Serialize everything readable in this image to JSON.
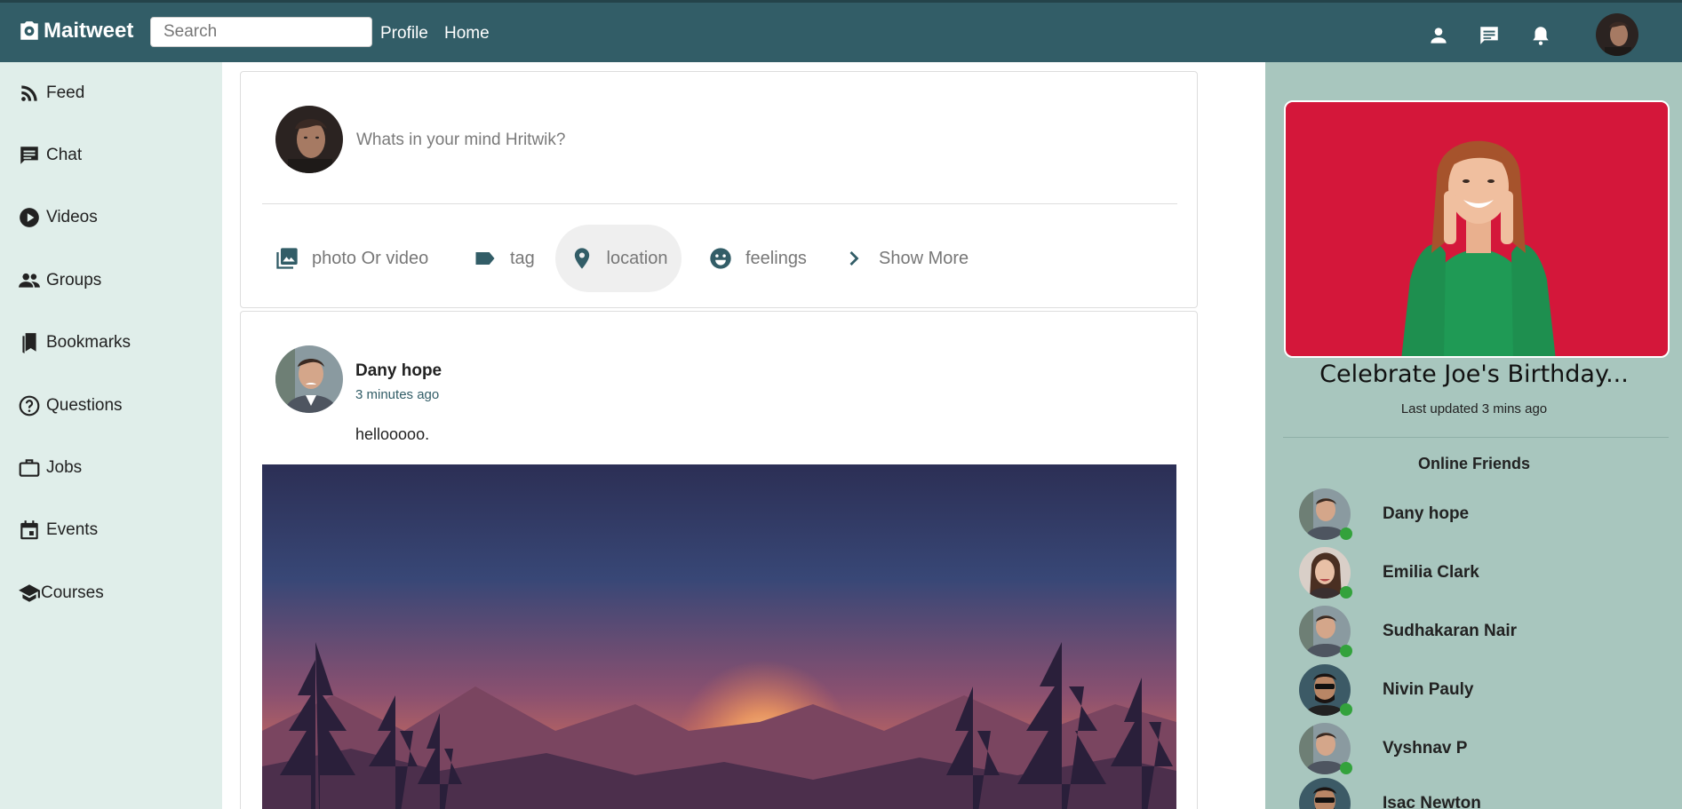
{
  "header": {
    "brand": "Maitweet",
    "search_placeholder": "Search",
    "nav": [
      "Profile",
      "Home"
    ],
    "icons": [
      "person-icon",
      "chat-icon",
      "bell-icon"
    ]
  },
  "sidebar": {
    "items": [
      {
        "label": "Feed",
        "icon": "rss-icon"
      },
      {
        "label": "Chat",
        "icon": "chat-icon"
      },
      {
        "label": "Videos",
        "icon": "play-icon"
      },
      {
        "label": "Groups",
        "icon": "group-icon"
      },
      {
        "label": "Bookmarks",
        "icon": "bookmark-icon"
      },
      {
        "label": "Questions",
        "icon": "help-icon"
      },
      {
        "label": "Jobs",
        "icon": "briefcase-icon"
      },
      {
        "label": "Events",
        "icon": "calendar-icon"
      },
      {
        "label": "Courses",
        "icon": "school-icon"
      }
    ]
  },
  "composer": {
    "placeholder": "Whats in your mind Hritwik?",
    "options": [
      {
        "label": "photo Or video",
        "icon": "photo-library-icon"
      },
      {
        "label": "tag",
        "icon": "label-icon"
      },
      {
        "label": "location",
        "icon": "location-pin-icon"
      },
      {
        "label": "feelings",
        "icon": "smiley-icon"
      },
      {
        "label": "Show More",
        "icon": "chevron-right-icon"
      }
    ]
  },
  "post": {
    "author": "Dany hope",
    "time": "3 minutes ago",
    "text": "hellooooo."
  },
  "promo": {
    "title": "Celebrate Joe's Birthday...",
    "subtitle": "Last updated 3 mins ago"
  },
  "online_friends": {
    "title": "Online Friends",
    "friends": [
      "Dany hope",
      "Emilia Clark",
      "Sudhakaran Nair",
      "Nivin Pauly",
      "Vyshnav P",
      "Isac Newton"
    ]
  },
  "colors": {
    "header_bg": "#325d67",
    "sidebar_bg": "#e0eeea",
    "rightbar_bg": "#a8c6be",
    "online_dot": "#33a23c"
  }
}
